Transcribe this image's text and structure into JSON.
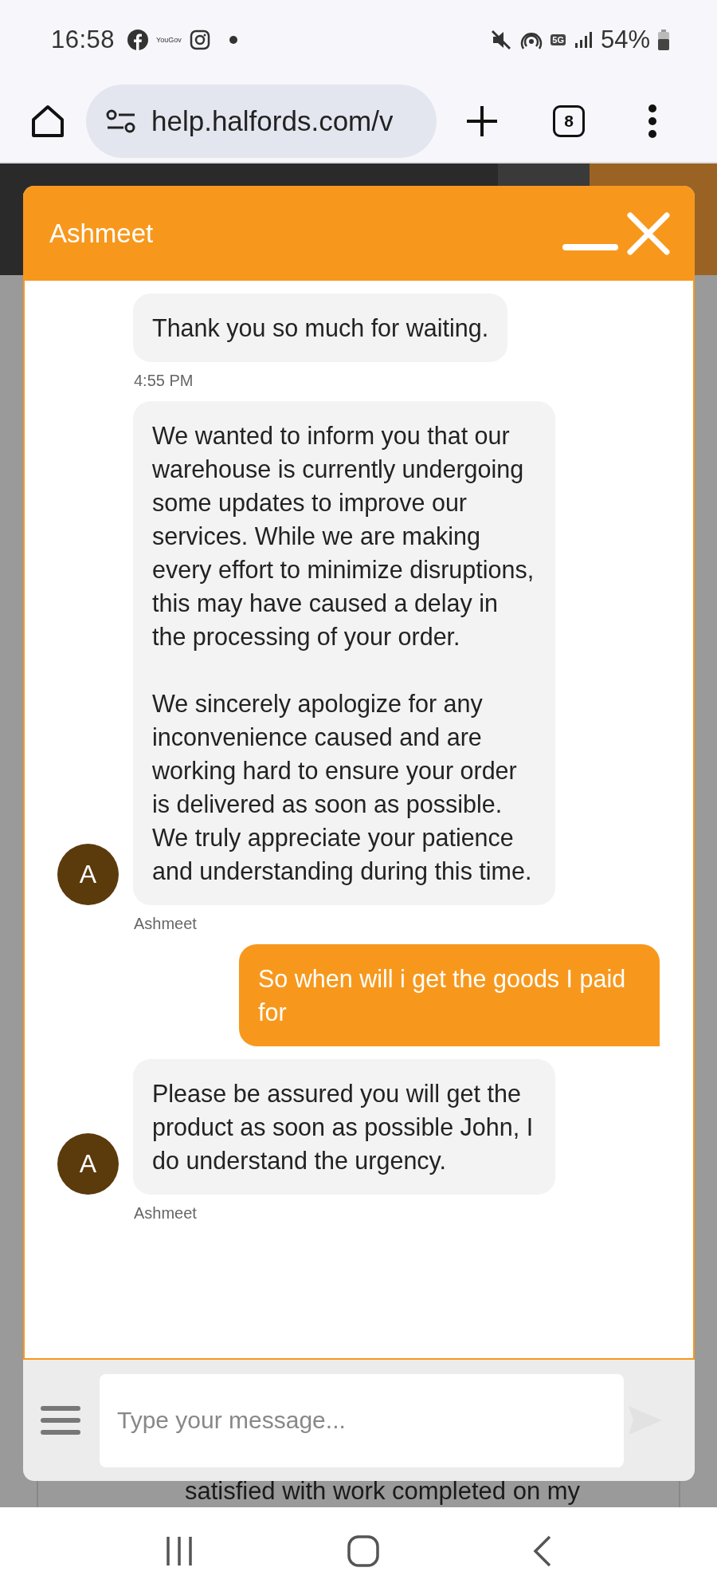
{
  "status_bar": {
    "time": "16:58",
    "app_label": "YouGov",
    "network": "5G",
    "battery": "54%"
  },
  "browser": {
    "url": "help.halfords.com/v",
    "tab_count": "8"
  },
  "chat": {
    "title": "Ashmeet",
    "messages": [
      {
        "kind": "agent",
        "paragraphs": [
          "Thank you so much for waiting."
        ]
      },
      {
        "kind": "timestamp",
        "text": "4:55 PM"
      },
      {
        "kind": "agent",
        "avatar": "A",
        "sender": "Ashmeet",
        "paragraphs": [
          "We wanted to inform you that our warehouse is currently undergoing some updates to improve our services. While we are making every effort to minimize disruptions, this may have caused a delay in the processing of your order.",
          "We sincerely apologize for any inconvenience caused and are working hard to ensure your order is delivered as soon as possible. We truly appreciate your patience and understanding during this time."
        ]
      },
      {
        "kind": "user",
        "paragraphs": [
          "So when will i get the goods I paid for"
        ]
      },
      {
        "kind": "agent",
        "avatar": "A",
        "sender": "Ashmeet",
        "paragraphs": [
          "Please be assured you will get the product as soon as possible John, I do understand the urgency."
        ]
      }
    ],
    "input": {
      "placeholder": "Type your message..."
    }
  },
  "background_text": "satisfied with work completed on my"
}
